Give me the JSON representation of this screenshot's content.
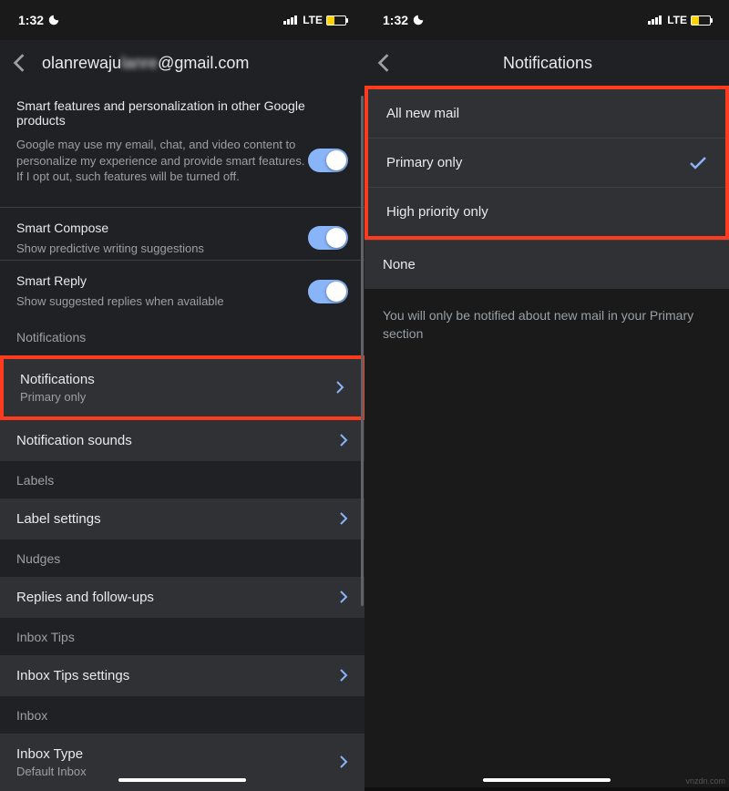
{
  "status": {
    "time": "1:32",
    "network": "LTE"
  },
  "left": {
    "title_prefix": "olanrewaju",
    "title_blur": "lanre",
    "title_suffix": "@gmail.com",
    "smart_features": {
      "title": "Smart features and personalization in other Google products",
      "desc": "Google may use my email, chat, and video content to personalize my experience and provide smart features. If I opt out, such features will be turned off."
    },
    "smart_compose": {
      "title": "Smart Compose",
      "desc": "Show predictive writing suggestions"
    },
    "smart_reply": {
      "title": "Smart Reply",
      "desc": "Show suggested replies when available"
    },
    "section_notifications": "Notifications",
    "notifications": {
      "title": "Notifications",
      "sub": "Primary only"
    },
    "notification_sounds": "Notification sounds",
    "section_labels": "Labels",
    "label_settings": "Label settings",
    "section_nudges": "Nudges",
    "replies_followups": "Replies and follow-ups",
    "section_inbox_tips": "Inbox Tips",
    "inbox_tips_settings": "Inbox Tips settings",
    "section_inbox": "Inbox",
    "inbox_type": {
      "title": "Inbox Type",
      "sub": "Default Inbox"
    }
  },
  "right": {
    "title": "Notifications",
    "options": {
      "all": "All new mail",
      "primary": "Primary only",
      "high": "High priority only",
      "none": "None"
    },
    "footer": "You will only be notified about new mail in your Primary section"
  },
  "watermark": "vnzdn.com"
}
